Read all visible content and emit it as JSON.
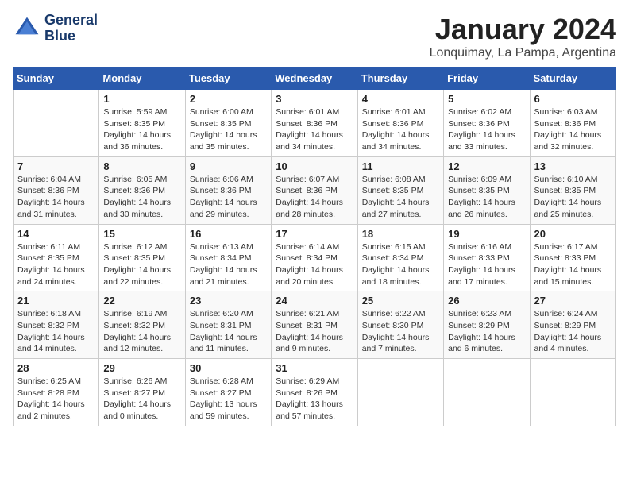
{
  "logo": {
    "line1": "General",
    "line2": "Blue"
  },
  "title": "January 2024",
  "subtitle": "Lonquimay, La Pampa, Argentina",
  "weekdays": [
    "Sunday",
    "Monday",
    "Tuesday",
    "Wednesday",
    "Thursday",
    "Friday",
    "Saturday"
  ],
  "weeks": [
    [
      {
        "day": "",
        "info": ""
      },
      {
        "day": "1",
        "info": "Sunrise: 5:59 AM\nSunset: 8:35 PM\nDaylight: 14 hours\nand 36 minutes."
      },
      {
        "day": "2",
        "info": "Sunrise: 6:00 AM\nSunset: 8:35 PM\nDaylight: 14 hours\nand 35 minutes."
      },
      {
        "day": "3",
        "info": "Sunrise: 6:01 AM\nSunset: 8:36 PM\nDaylight: 14 hours\nand 34 minutes."
      },
      {
        "day": "4",
        "info": "Sunrise: 6:01 AM\nSunset: 8:36 PM\nDaylight: 14 hours\nand 34 minutes."
      },
      {
        "day": "5",
        "info": "Sunrise: 6:02 AM\nSunset: 8:36 PM\nDaylight: 14 hours\nand 33 minutes."
      },
      {
        "day": "6",
        "info": "Sunrise: 6:03 AM\nSunset: 8:36 PM\nDaylight: 14 hours\nand 32 minutes."
      }
    ],
    [
      {
        "day": "7",
        "info": "Sunrise: 6:04 AM\nSunset: 8:36 PM\nDaylight: 14 hours\nand 31 minutes."
      },
      {
        "day": "8",
        "info": "Sunrise: 6:05 AM\nSunset: 8:36 PM\nDaylight: 14 hours\nand 30 minutes."
      },
      {
        "day": "9",
        "info": "Sunrise: 6:06 AM\nSunset: 8:36 PM\nDaylight: 14 hours\nand 29 minutes."
      },
      {
        "day": "10",
        "info": "Sunrise: 6:07 AM\nSunset: 8:36 PM\nDaylight: 14 hours\nand 28 minutes."
      },
      {
        "day": "11",
        "info": "Sunrise: 6:08 AM\nSunset: 8:35 PM\nDaylight: 14 hours\nand 27 minutes."
      },
      {
        "day": "12",
        "info": "Sunrise: 6:09 AM\nSunset: 8:35 PM\nDaylight: 14 hours\nand 26 minutes."
      },
      {
        "day": "13",
        "info": "Sunrise: 6:10 AM\nSunset: 8:35 PM\nDaylight: 14 hours\nand 25 minutes."
      }
    ],
    [
      {
        "day": "14",
        "info": "Sunrise: 6:11 AM\nSunset: 8:35 PM\nDaylight: 14 hours\nand 24 minutes."
      },
      {
        "day": "15",
        "info": "Sunrise: 6:12 AM\nSunset: 8:35 PM\nDaylight: 14 hours\nand 22 minutes."
      },
      {
        "day": "16",
        "info": "Sunrise: 6:13 AM\nSunset: 8:34 PM\nDaylight: 14 hours\nand 21 minutes."
      },
      {
        "day": "17",
        "info": "Sunrise: 6:14 AM\nSunset: 8:34 PM\nDaylight: 14 hours\nand 20 minutes."
      },
      {
        "day": "18",
        "info": "Sunrise: 6:15 AM\nSunset: 8:34 PM\nDaylight: 14 hours\nand 18 minutes."
      },
      {
        "day": "19",
        "info": "Sunrise: 6:16 AM\nSunset: 8:33 PM\nDaylight: 14 hours\nand 17 minutes."
      },
      {
        "day": "20",
        "info": "Sunrise: 6:17 AM\nSunset: 8:33 PM\nDaylight: 14 hours\nand 15 minutes."
      }
    ],
    [
      {
        "day": "21",
        "info": "Sunrise: 6:18 AM\nSunset: 8:32 PM\nDaylight: 14 hours\nand 14 minutes."
      },
      {
        "day": "22",
        "info": "Sunrise: 6:19 AM\nSunset: 8:32 PM\nDaylight: 14 hours\nand 12 minutes."
      },
      {
        "day": "23",
        "info": "Sunrise: 6:20 AM\nSunset: 8:31 PM\nDaylight: 14 hours\nand 11 minutes."
      },
      {
        "day": "24",
        "info": "Sunrise: 6:21 AM\nSunset: 8:31 PM\nDaylight: 14 hours\nand 9 minutes."
      },
      {
        "day": "25",
        "info": "Sunrise: 6:22 AM\nSunset: 8:30 PM\nDaylight: 14 hours\nand 7 minutes."
      },
      {
        "day": "26",
        "info": "Sunrise: 6:23 AM\nSunset: 8:29 PM\nDaylight: 14 hours\nand 6 minutes."
      },
      {
        "day": "27",
        "info": "Sunrise: 6:24 AM\nSunset: 8:29 PM\nDaylight: 14 hours\nand 4 minutes."
      }
    ],
    [
      {
        "day": "28",
        "info": "Sunrise: 6:25 AM\nSunset: 8:28 PM\nDaylight: 14 hours\nand 2 minutes."
      },
      {
        "day": "29",
        "info": "Sunrise: 6:26 AM\nSunset: 8:27 PM\nDaylight: 14 hours\nand 0 minutes."
      },
      {
        "day": "30",
        "info": "Sunrise: 6:28 AM\nSunset: 8:27 PM\nDaylight: 13 hours\nand 59 minutes."
      },
      {
        "day": "31",
        "info": "Sunrise: 6:29 AM\nSunset: 8:26 PM\nDaylight: 13 hours\nand 57 minutes."
      },
      {
        "day": "",
        "info": ""
      },
      {
        "day": "",
        "info": ""
      },
      {
        "day": "",
        "info": ""
      }
    ]
  ]
}
